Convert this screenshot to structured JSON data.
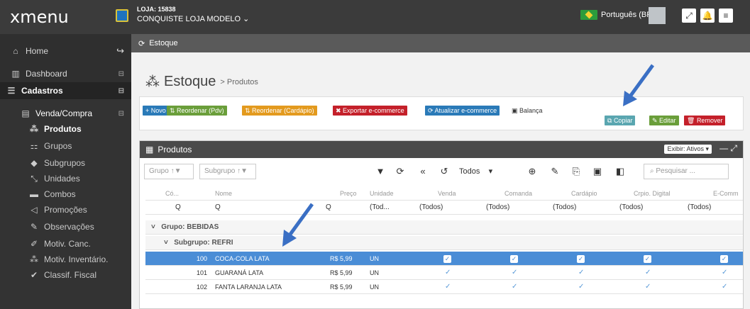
{
  "app": {
    "logo": "xmenu",
    "store_code": "LOJA: 15838",
    "store_name": "CONQUISTE LOJA MODELO",
    "language": "Português (BR)"
  },
  "sidebar": {
    "items": [
      {
        "label": "Home",
        "icon": "home-icon"
      },
      {
        "label": "Dashboard",
        "icon": "chart-icon"
      },
      {
        "label": "Cadastros",
        "icon": "database-icon"
      },
      {
        "label": "Venda/Compra",
        "icon": "list-icon"
      },
      {
        "label": "Produtos",
        "icon": "cubes-icon"
      },
      {
        "label": "Grupos",
        "icon": "sitemap-icon"
      },
      {
        "label": "Subgrupos",
        "icon": "tag-icon"
      },
      {
        "label": "Unidades",
        "icon": "expand-icon"
      },
      {
        "label": "Combos",
        "icon": "car-icon"
      },
      {
        "label": "Promoções",
        "icon": "bullhorn-icon"
      },
      {
        "label": "Observações",
        "icon": "pencil-icon"
      },
      {
        "label": "Motiv. Canc.",
        "icon": "pencil-icon"
      },
      {
        "label": "Motiv. Inventário.",
        "icon": "cubes-icon"
      },
      {
        "label": "Classif. Fiscal",
        "icon": "check-icon"
      }
    ]
  },
  "tab": {
    "label": "Estoque"
  },
  "page": {
    "title": "Estoque",
    "breadcrumb": "> Produtos"
  },
  "actions": {
    "novo": "+ Novo",
    "reord_pdv": "Reordenar (Pdv)",
    "reord_card": "Reordenar (Cardápio)",
    "exportar": "Exportar e-commerce",
    "atualizar": "Atualizar e-commerce",
    "balanca": "Balança",
    "copiar": "Copiar",
    "editar": "Editar",
    "remover": "Remover"
  },
  "panel": {
    "title": "Produtos",
    "exibir": "Exibir: Ativos",
    "grupo": "Grupo",
    "subgrupo": "Subgrupo",
    "todos": "Todos",
    "search_placeholder": "Pesquisar ..."
  },
  "table": {
    "headers": [
      "Có...",
      "Nome",
      "Preço",
      "Unidade",
      "Venda",
      "Comanda",
      "Cardápio",
      "Crpio. Digital",
      "E-Comm"
    ],
    "filters": [
      "Q",
      "Q",
      "Q",
      "(Tod...",
      "(Todos)",
      "(Todos)",
      "(Todos)",
      "(Todos)",
      "(Todos)"
    ],
    "group_label": "Grupo: BEBIDAS",
    "subgroup_label": "Subgrupo: REFRI",
    "rows": [
      {
        "code": "100",
        "name": "COCA-COLA LATA",
        "price": "R$ 5,99",
        "unit": "UN"
      },
      {
        "code": "101",
        "name": "GUARANÁ LATA",
        "price": "R$ 5,99",
        "unit": "UN"
      },
      {
        "code": "102",
        "name": "FANTA LARANJA LATA",
        "price": "R$ 5,99",
        "unit": "UN"
      }
    ]
  },
  "colors": {
    "topbar": "#3b3b3b",
    "sidebar": "#2f2f2f",
    "accent": "#4a8dd6",
    "arrow": "#3a6fc4"
  }
}
